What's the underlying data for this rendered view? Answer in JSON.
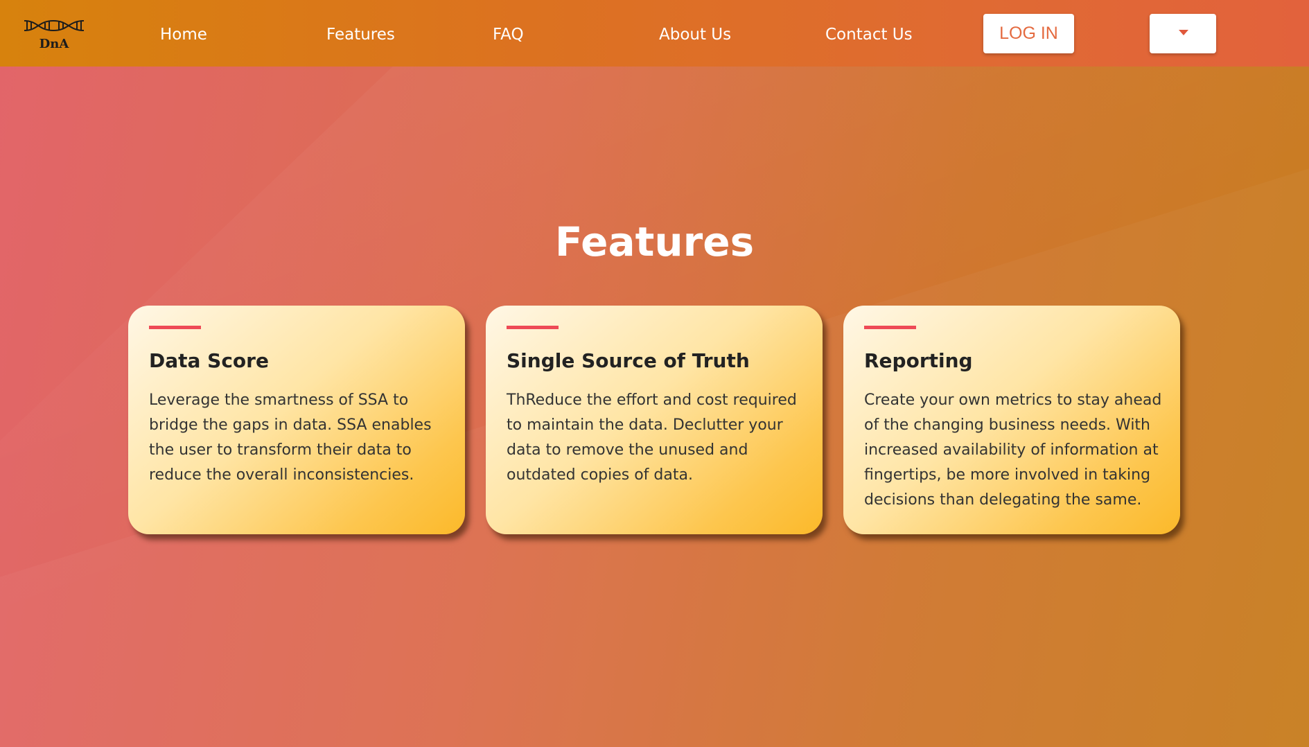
{
  "brand": {
    "logo_text": "DnA"
  },
  "nav": {
    "links": [
      {
        "label": "Home"
      },
      {
        "label": "Features"
      },
      {
        "label": "FAQ"
      },
      {
        "label": "About Us"
      },
      {
        "label": "Contact Us"
      }
    ],
    "login_label": "LOG IN"
  },
  "features": {
    "title": "Features",
    "cards": [
      {
        "title": "Data Score",
        "text": "Leverage the smartness of SSA to bridge the gaps in data. SSA enables the user to transform their data to reduce the overall inconsistencies."
      },
      {
        "title": "Single Source of Truth",
        "text": "ThReduce the effort and cost required to maintain the data. Declutter your data to remove the unused and outdated copies of data."
      },
      {
        "title": "Reporting",
        "text": "Create your own metrics to stay ahead of the changing business needs. With increased availability of information at fingertips, be more involved in taking decisions than delegating the same."
      }
    ]
  },
  "icons": {
    "logo": "dna-helix-icon",
    "dropdown": "caret-down-icon"
  },
  "colors": {
    "accent_bar": "#ee4a56",
    "login_text": "#e46a3f",
    "card_gradient_end": "#fbb92a"
  }
}
